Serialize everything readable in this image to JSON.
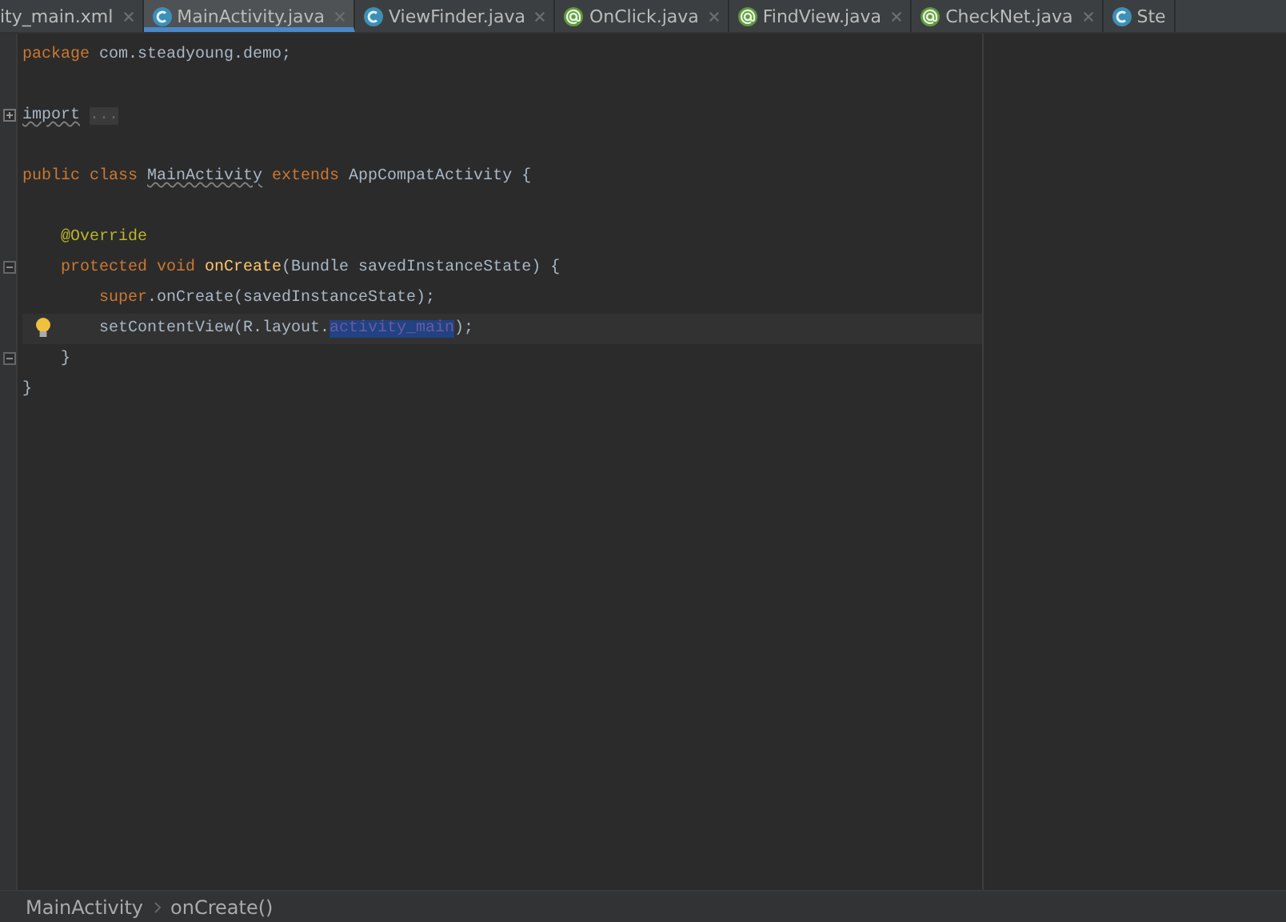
{
  "tabs": [
    {
      "label": "ity_main.xml",
      "kind": "plain",
      "selected": false,
      "closable": true
    },
    {
      "label": "MainActivity.java",
      "kind": "class",
      "selected": true,
      "closable": true
    },
    {
      "label": "ViewFinder.java",
      "kind": "class",
      "selected": false,
      "closable": true
    },
    {
      "label": "OnClick.java",
      "kind": "annotation",
      "selected": false,
      "closable": true
    },
    {
      "label": "FindView.java",
      "kind": "annotation",
      "selected": false,
      "closable": true
    },
    {
      "label": "CheckNet.java",
      "kind": "annotation",
      "selected": false,
      "closable": true
    },
    {
      "label": "Ste",
      "kind": "class",
      "selected": false,
      "closable": false
    }
  ],
  "editor": {
    "lines": [
      {
        "kind": "code",
        "tokens": [
          {
            "text": "package",
            "kind": "keyword"
          },
          {
            "text": " com.steadyoung.demo;",
            "kind": "plain"
          }
        ]
      },
      {
        "kind": "blank"
      },
      {
        "kind": "code",
        "fold": {
          "kind": "expand"
        },
        "tokens": [
          {
            "text": "import",
            "kind": "warning"
          },
          {
            "text": "...",
            "kind": "folded"
          }
        ]
      },
      {
        "kind": "blank"
      },
      {
        "kind": "code",
        "tokens": [
          {
            "text": "public class ",
            "kind": "keyword"
          },
          {
            "text": "MainActivity",
            "kind": "warning"
          },
          {
            "text": " extends",
            "kind": "keyword"
          },
          {
            "text": " AppCompatActivity {",
            "kind": "plain"
          }
        ]
      },
      {
        "kind": "blank"
      },
      {
        "kind": "code",
        "tokens": [
          {
            "text": "    @Override",
            "kind": "annotation"
          }
        ]
      },
      {
        "kind": "code",
        "fold": {
          "kind": "collapse"
        },
        "tokens": [
          {
            "text": "    protected void ",
            "kind": "keyword"
          },
          {
            "text": "onCreate",
            "kind": "method"
          },
          {
            "text": "(Bundle savedInstanceState) {",
            "kind": "plain"
          }
        ]
      },
      {
        "kind": "code",
        "tokens": [
          {
            "text": "        super",
            "kind": "keyword"
          },
          {
            "text": ".onCreate(savedInstanceState);",
            "kind": "plain"
          }
        ]
      },
      {
        "kind": "code",
        "bulb": true,
        "current": true,
        "tokens": [
          {
            "text": "        setContentView(R.layout.",
            "kind": "plain"
          },
          {
            "text": "activity_main",
            "kind": "selected"
          },
          {
            "text": ");",
            "kind": "plain"
          }
        ]
      },
      {
        "kind": "code",
        "fold": {
          "kind": "end"
        },
        "tokens": [
          {
            "text": "    }",
            "kind": "plain"
          }
        ]
      },
      {
        "kind": "code",
        "tokens": [
          {
            "text": "}",
            "kind": "plain"
          }
        ]
      }
    ]
  },
  "breadcrumbs": [
    "MainActivity",
    "onCreate()"
  ]
}
